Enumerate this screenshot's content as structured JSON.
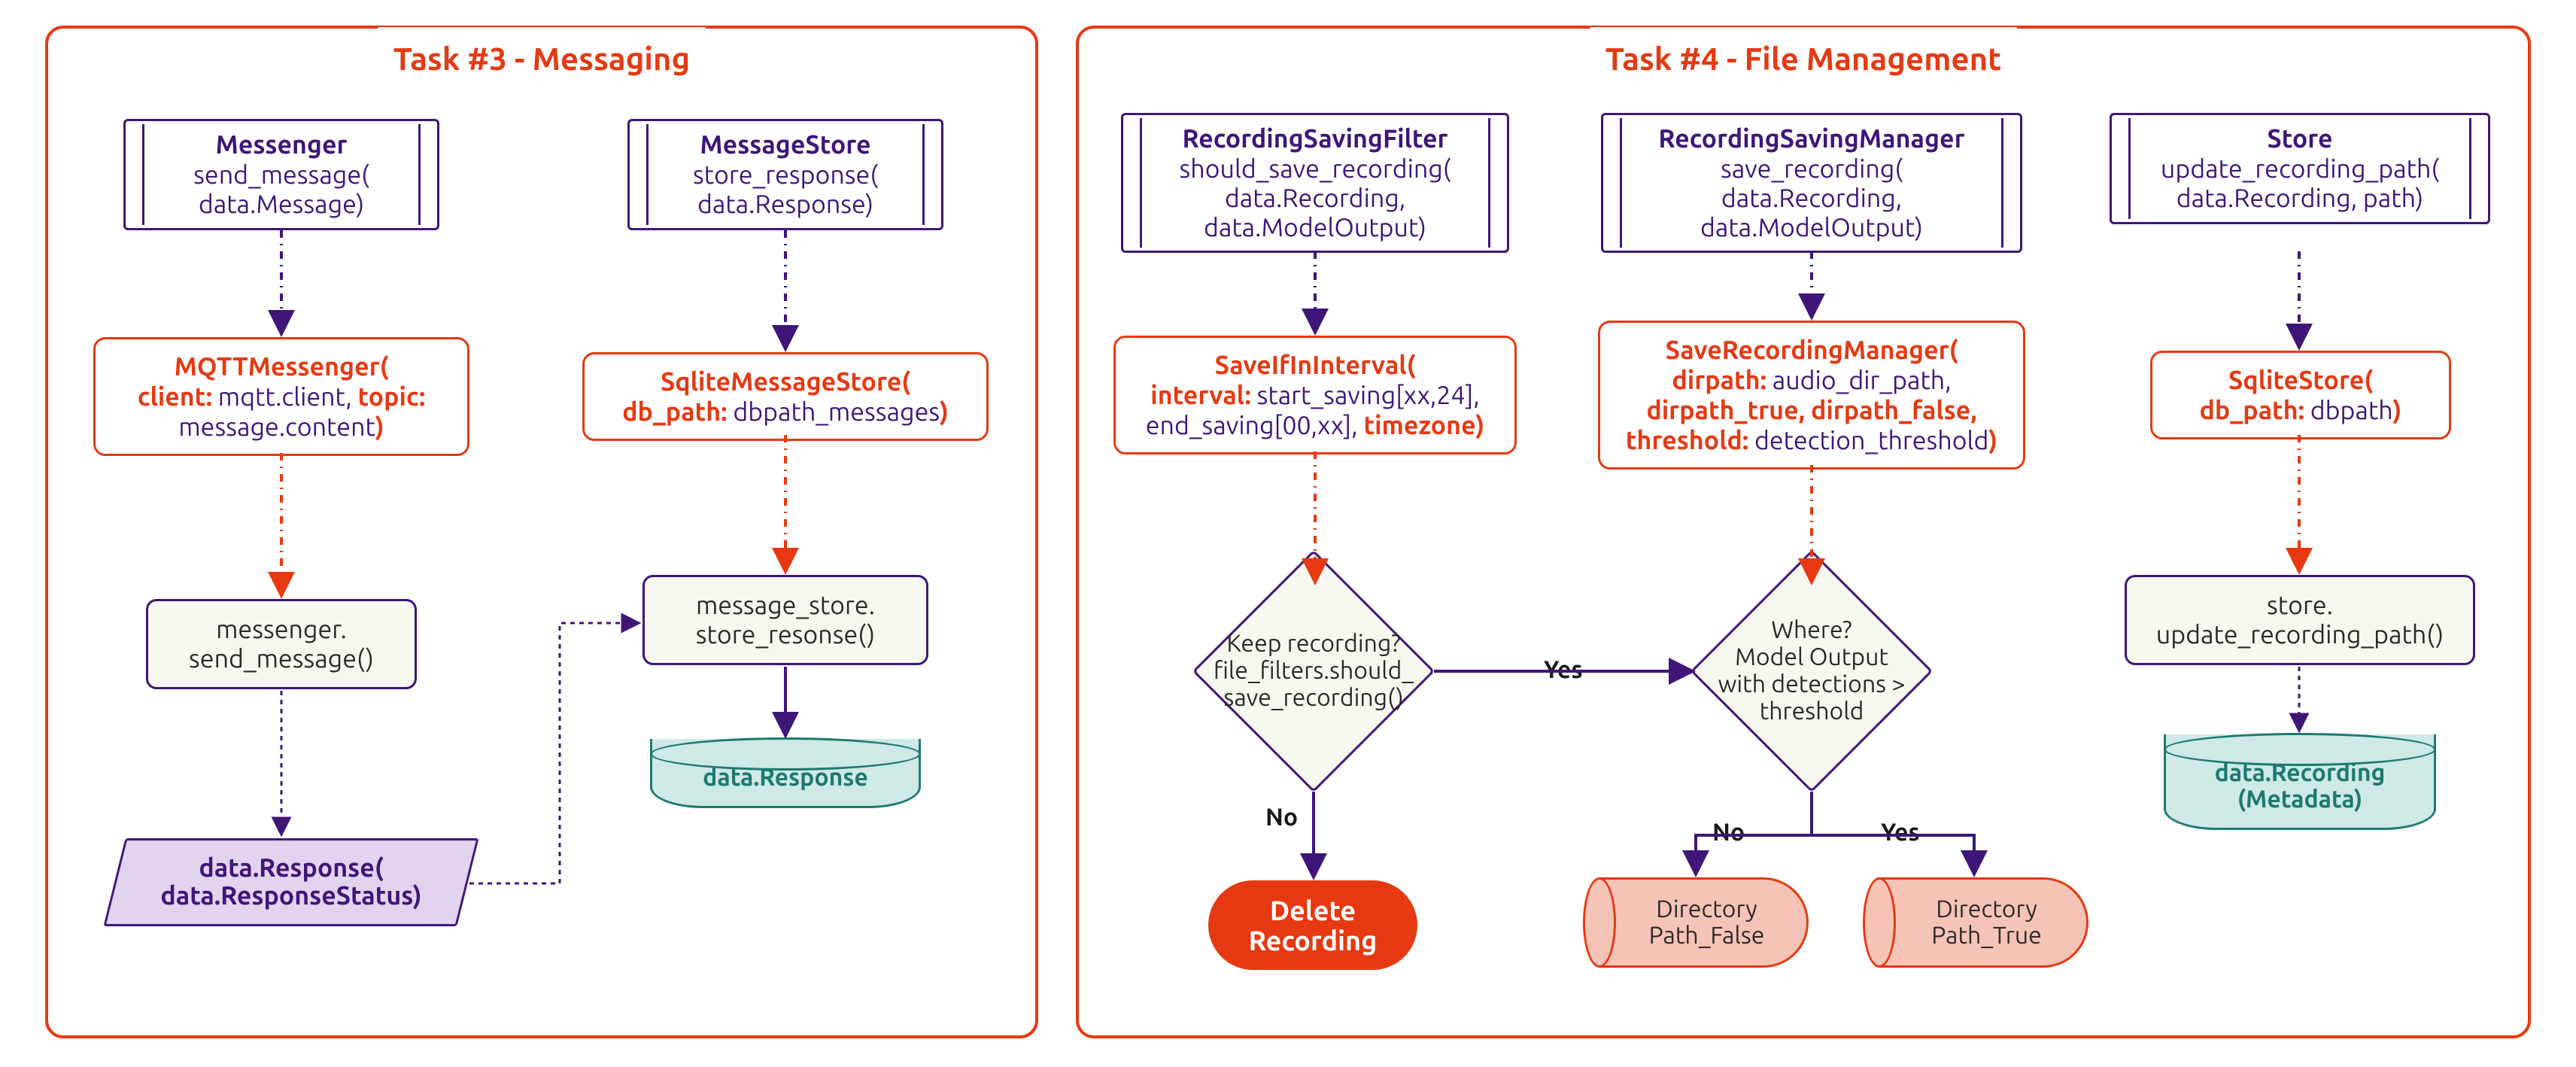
{
  "panel3": {
    "title": "Task #3 - Messaging",
    "messenger_if": {
      "title": "Messenger",
      "body": "send_message(\ndata.Message)"
    },
    "msgstore_if": {
      "title": "MessageStore",
      "body": "store_response(\ndata.Response)"
    },
    "mqtt_impl": {
      "line1_key": "MQTTMessenger(",
      "line2_key": "client:",
      "line2_val": " mqtt.client, ",
      "line2_key2": "topic:",
      "line3_val": "message.content",
      "line3_close": ")"
    },
    "sqlite_msg_impl": {
      "line1_key": "SqliteMessageStore(",
      "line2_key": "db_path:",
      "line2_val": " dbpath_messages",
      "line2_close": ")"
    },
    "call_send": "messenger.\nsend_message()",
    "call_store": "message_store.\nstore_resonse()",
    "para": "data.Response(\ndata.ResponseStatus)",
    "db1": "data.Response"
  },
  "panel4": {
    "title": "Task #4 - File Management",
    "filter_if": {
      "title": "RecordingSavingFilter",
      "body": "should_save_recording(\ndata.Recording,\ndata.ModelOutput)"
    },
    "mgr_if": {
      "title": "RecordingSavingManager",
      "body": "save_recording(\ndata.Recording,\ndata.ModelOutput)"
    },
    "store_if": {
      "title": "Store",
      "body": "update_recording_path(\ndata.Recording, path)"
    },
    "interval_impl": {
      "line1_key": "SaveIfInInterval(",
      "line2_key": "interval:",
      "line2_val": " start_saving[xx,24],",
      "line3_val": "end_saving[00,xx], ",
      "line3_key": "timezone",
      "line3_close": ")"
    },
    "savemgr_impl": {
      "line1_key": "SaveRecordingManager(",
      "line2_key": "dirpath:",
      "line2_val": " audio_dir_path,",
      "line3_key": "dirpath_true, dirpath_false,",
      "line4_key": "threshold:",
      "line4_val": " detection_threshold",
      "line4_close": ")"
    },
    "sqlite_impl": {
      "line1_key": "SqliteStore(",
      "line2_key": "db_path:",
      "line2_val": " dbpath",
      "line2_close": ")"
    },
    "dec1": "Keep recording?\nfile_filters.should_\nsave_recording()",
    "dec2": "Where?\nModel Output\nwith detections >\nthreshold",
    "call_upd": "store.\nupdate_recording_path()",
    "delete": "Delete\nRecording",
    "dir_false": "Directory\nPath_False",
    "dir_true": "Directory\nPath_True",
    "db2": "data.Recording\n(Metadata)",
    "labels": {
      "yes1": "Yes",
      "no1": "No",
      "yes2": "Yes",
      "no2": "No"
    }
  },
  "colors": {
    "accent": "#e63912",
    "purple": "#3f1678",
    "teal": "#1d7a70"
  }
}
